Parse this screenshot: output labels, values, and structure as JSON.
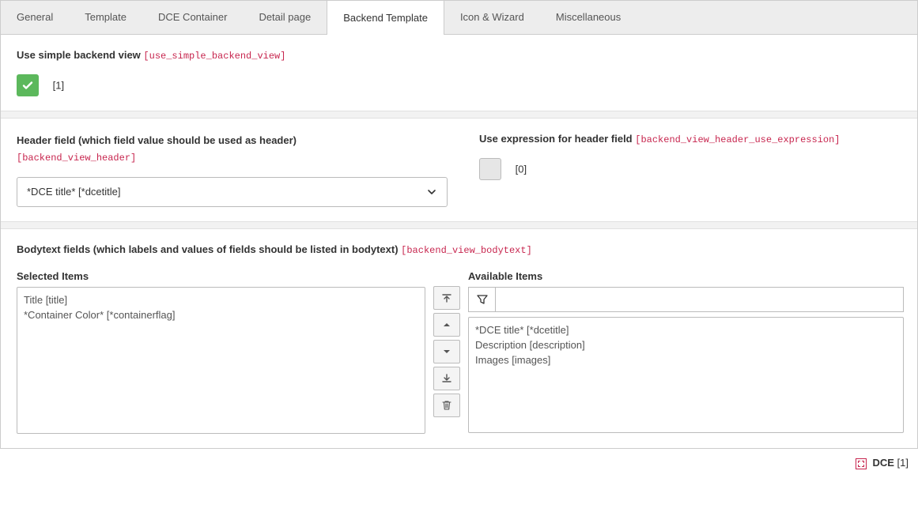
{
  "tabs": [
    {
      "label": "General"
    },
    {
      "label": "Template"
    },
    {
      "label": "DCE Container"
    },
    {
      "label": "Detail page"
    },
    {
      "label": "Backend Template",
      "active": true
    },
    {
      "label": "Icon & Wizard"
    },
    {
      "label": "Miscellaneous"
    }
  ],
  "simple": {
    "label": "Use simple backend view",
    "key": "[use_simple_backend_view]",
    "value_label": "[1]"
  },
  "header_field": {
    "label": "Header field (which field value should be used as header)",
    "key": "[backend_view_header]",
    "selected": "*DCE title* [*dcetitle]"
  },
  "header_expr": {
    "label": "Use expression for header field",
    "key": "[backend_view_header_use_expression]",
    "value_label": "[0]"
  },
  "bodytext": {
    "label": "Bodytext fields (which labels and values of fields should be listed in bodytext)",
    "key": "[backend_view_bodytext]",
    "selected_header": "Selected Items",
    "available_header": "Available Items",
    "selected_items": [
      "Title [title]",
      "*Container Color* [*containerflag]"
    ],
    "available_items": [
      "*DCE title* [*dcetitle]",
      "Description [description]",
      "Images [images]"
    ],
    "filter_placeholder": ""
  },
  "footer": {
    "label": "DCE",
    "count": "[1]"
  }
}
